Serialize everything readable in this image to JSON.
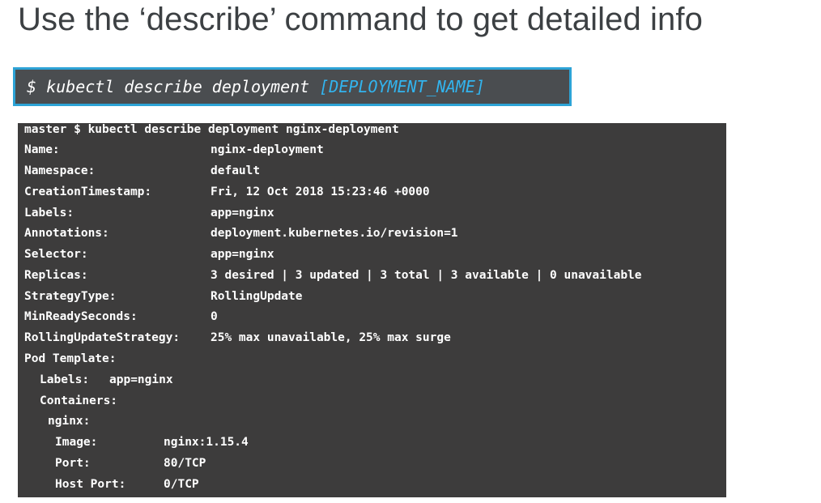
{
  "slide": {
    "title": "Use the ‘describe’ command to get detailed info"
  },
  "command": {
    "prompt": "$ kubectl describe deployment ",
    "placeholder": "[DEPLOYMENT_NAME]"
  },
  "terminal": {
    "header": "master $ kubectl describe deployment nginx-deployment",
    "fields": [
      {
        "key": "Name:",
        "value": "nginx-deployment"
      },
      {
        "key": "Namespace:",
        "value": "default"
      },
      {
        "key": "CreationTimestamp:",
        "value": "Fri, 12 Oct 2018 15:23:46 +0000"
      },
      {
        "key": "Labels:",
        "value": "app=nginx"
      },
      {
        "key": "Annotations:",
        "value": "deployment.kubernetes.io/revision=1"
      },
      {
        "key": "Selector:",
        "value": "app=nginx"
      },
      {
        "key": "Replicas:",
        "value": "3 desired | 3 updated | 3 total | 3 available | 0 unavailable"
      },
      {
        "key": "StrategyType:",
        "value": "RollingUpdate"
      },
      {
        "key": "MinReadySeconds:",
        "value": "0"
      },
      {
        "key": "RollingUpdateStrategy:",
        "value": "25% max unavailable, 25% max surge"
      },
      {
        "key": "Pod Template:",
        "value": ""
      }
    ],
    "pod_template": {
      "labels_key": "Labels:",
      "labels_value": "app=nginx",
      "containers_key": "Containers:",
      "container_name": "nginx:",
      "image_key": "Image:",
      "image_value": "nginx:1.15.4",
      "port_key": "Port:",
      "port_value": "80/TCP",
      "host_port_key": "Host Port:",
      "host_port_value": "0/TCP"
    }
  }
}
